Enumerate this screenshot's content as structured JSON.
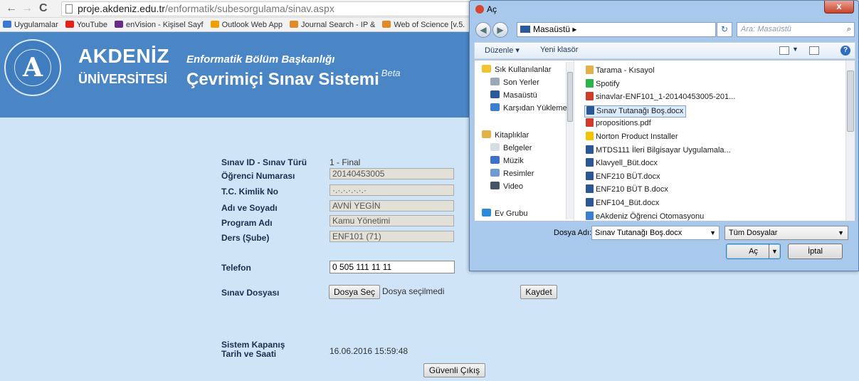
{
  "browser": {
    "url_host": "proje.akdeniz.edu.tr",
    "url_path": "/enformatik/subesorgulama/sinav.aspx",
    "back": "←",
    "forward": "→",
    "reload": "C",
    "bookmarks": [
      {
        "label": "Uygulamalar",
        "color": "#3a78d4"
      },
      {
        "label": "YouTube",
        "color": "#e62117"
      },
      {
        "label": "enVision - Kişisel Sayf",
        "color": "#6a2a8a"
      },
      {
        "label": "Outlook Web App",
        "color": "#f0a000"
      },
      {
        "label": "Journal Search - IP &",
        "color": "#e08a2a"
      },
      {
        "label": "Web of Science [v.5.",
        "color": "#e08a2a"
      }
    ]
  },
  "header": {
    "logo_letter": "A",
    "uni_name_1": "AKDENİZ",
    "uni_name_2": "ÜNİVERSİTESİ",
    "dept": "Enformatik Bölüm Başkanlığı",
    "system": "Çevrimiçi Sınav Sistemi",
    "beta": "Beta"
  },
  "form": {
    "exam_label": "Sınav ID - Sınav Türü",
    "exam_value": "1  - Final",
    "student_no_label": "Öğrenci Numarası",
    "student_no_value": "20140453005",
    "tc_label": "T.C. Kimlik No",
    "tc_value": "·.·.·.·.·.·.·",
    "name_label": "Adı ve Soyadı",
    "name_value": "AVNİ YEGİN",
    "program_label": "Program Adı",
    "program_value": "Kamu Yönetimi",
    "course_label": "Ders (Şube)",
    "course_value": "ENF101 (71)",
    "phone_label": "Telefon",
    "phone_value": "0 505 111 11 11",
    "file_label": "Sınav Dosyası",
    "choose_file": "Dosya Seç",
    "no_file": "Dosya seçilmedi",
    "save": "Kaydet",
    "close_label_1": "Sistem Kapanış",
    "close_label_2": "Tarih ve Saati",
    "close_value": "16.06.2016 15:59:48",
    "logout": "Güvenli Çıkış"
  },
  "dialog": {
    "title": "Aç",
    "close": "x",
    "breadcrumb": "Masaüstü  ▸",
    "search_placeholder": "Ara: Masaüstü",
    "organize": "Düzenle ▾",
    "new_folder": "Yeni klasör",
    "nav_items": [
      {
        "label": "Sık Kullanılanlar",
        "color": "#f2c230"
      },
      {
        "label": "Son Yerler",
        "color": "#9aa8b8"
      },
      {
        "label": "Masaüstü",
        "color": "#2a5a9a"
      },
      {
        "label": "Karşıdan Yükleme",
        "color": "#3a7fd0"
      },
      {
        "label": "",
        "color": ""
      },
      {
        "label": "Kitaplıklar",
        "color": "#e3b04a"
      },
      {
        "label": "Belgeler",
        "color": "#d7dde5"
      },
      {
        "label": "Müzik",
        "color": "#3b72c8"
      },
      {
        "label": "Resimler",
        "color": "#6c9ad1"
      },
      {
        "label": "Video",
        "color": "#445566"
      },
      {
        "label": "",
        "color": ""
      },
      {
        "label": "Ev Grubu",
        "color": "#2f8ad6"
      }
    ],
    "files": [
      {
        "label": "Tarama - Kısayol",
        "color": "#e3b04a"
      },
      {
        "label": "Spotify",
        "color": "#2cb34a"
      },
      {
        "label": "sinavlar-ENF101_1-20140453005-201...",
        "color": "#d23b2a"
      },
      {
        "label": "Sınav Tutanağı Boş.docx",
        "color": "#2b5797",
        "selected": true
      },
      {
        "label": "propositions.pdf",
        "color": "#d23b2a"
      },
      {
        "label": "Norton Product Installer",
        "color": "#f5c400"
      },
      {
        "label": "MTDS111 İleri Bilgisayar Uygulamala...",
        "color": "#2b5797"
      },
      {
        "label": "Klavyell_Büt.docx",
        "color": "#2b5797"
      },
      {
        "label": "ENF210 BÜT.docx",
        "color": "#2b5797"
      },
      {
        "label": "ENF210 BÜT B.docx",
        "color": "#2b5797"
      },
      {
        "label": "ENF104_Büt.docx",
        "color": "#2b5797"
      },
      {
        "label": "eAkdeniz Öğrenci Otomasyonu",
        "color": "#3a7fd0"
      }
    ],
    "filename_label": "Dosya Adı:",
    "filename_value": "Sınav Tutanağı Boş.docx",
    "filetype_value": "Tüm Dosyalar",
    "open": "Aç",
    "cancel": "İptal"
  }
}
